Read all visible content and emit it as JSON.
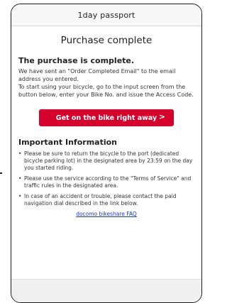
{
  "header": {
    "title": "1day passport"
  },
  "page": {
    "title": "Purchase complete"
  },
  "completion": {
    "heading": "The purchase is complete.",
    "line1": "We have sent an \"Order Completed Email\" to the email address you entered.",
    "line2": "To start using your bicycle, go to the input screen from the button below, enter your Bike No. and issue the Access Code."
  },
  "cta": {
    "label": "Get on the bike right away",
    "chevron": ">"
  },
  "info": {
    "heading": "Important Information",
    "bullet": "•",
    "items": [
      "Please be sure to return the bicycle to the port (dedicated bicycle parking lot) in the designated area by 23:59 on the day you started riding.",
      "Please use the service according to the \"Terms of Service\" and traffic rules in the designated area.",
      "In case of an accident or trouble, please contact the paid navigation dial described in the link below."
    ],
    "faq_link": "docomo bikeshare FAQ"
  },
  "colors": {
    "accent": "#d5002b",
    "link": "#1a37c8"
  }
}
